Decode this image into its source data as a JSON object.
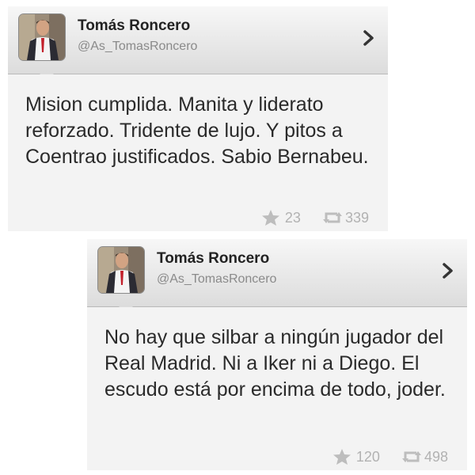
{
  "tweets": [
    {
      "name": "Tomás Roncero",
      "handle": "@As_TomasRoncero",
      "text": "Mision cumplida. Manita y liderato reforzado. Tridente de lujo. Y pitos a Coentrao justificados. Sabio Bernabeu.",
      "favorites": "23",
      "retweets": "339"
    },
    {
      "name": "Tomás Roncero",
      "handle": "@As_TomasRoncero",
      "text": "No hay que silbar a ningún jugador del Real Madrid. Ni a Iker ni a Diego. El escudo está por encima de todo, joder.",
      "favorites": "120",
      "retweets": "498"
    }
  ],
  "icons": {
    "favorite": "star-icon",
    "retweet": "retweet-icon",
    "open": "chevron-right-icon"
  },
  "colors": {
    "header_top": "#f7f7f7",
    "header_bottom": "#dcdcdc",
    "body": "#f3f3f3",
    "text": "#2a2a2a",
    "muted": "#b2b2b2"
  }
}
